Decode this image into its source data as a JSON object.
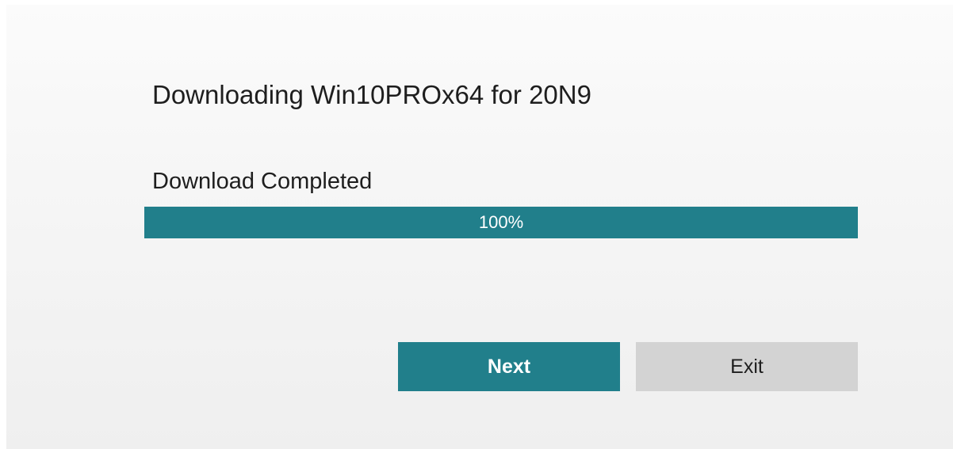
{
  "dialog": {
    "title": "Downloading Win10PROx64 for 20N9",
    "status": "Download Completed",
    "progress": {
      "value": 1.0,
      "label": "100%"
    },
    "buttons": {
      "next_label": "Next",
      "exit_label": "Exit"
    }
  },
  "colors": {
    "accent": "#217f8b",
    "secondary_button": "#d3d3d3",
    "background": "#f4f4f4",
    "text": "#1e1e1e"
  }
}
